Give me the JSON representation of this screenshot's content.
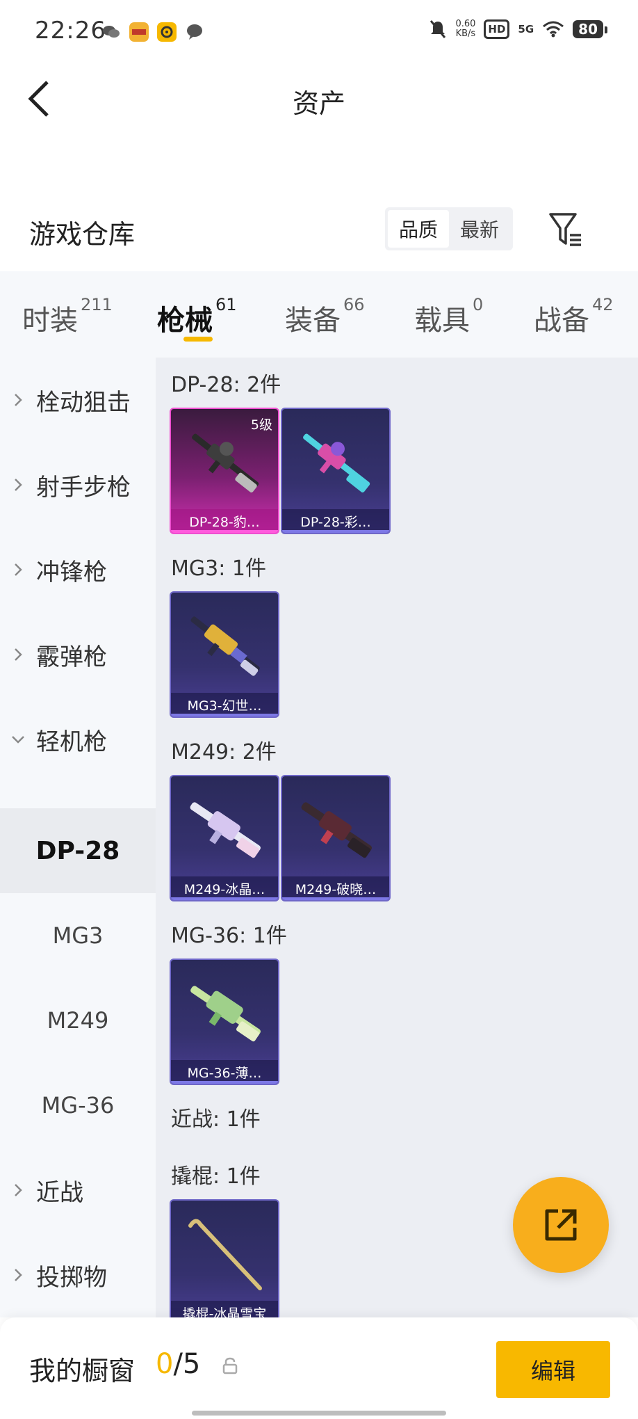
{
  "status_bar": {
    "time": "22:26",
    "net_speed_value": "0.60",
    "net_speed_unit": "KB/s",
    "hd": "HD",
    "network": "5G",
    "battery": "80"
  },
  "header": {
    "title": "资产"
  },
  "warehouse": {
    "title": "游戏仓库",
    "sort_options": [
      "品质",
      "最新"
    ],
    "active_sort": "品质"
  },
  "tabs": [
    {
      "label": "时装",
      "count": "211"
    },
    {
      "label": "枪械",
      "count": "61",
      "active": true
    },
    {
      "label": "装备",
      "count": "66"
    },
    {
      "label": "载具",
      "count": "0"
    },
    {
      "label": "战备",
      "count": "42"
    }
  ],
  "sidebar": [
    {
      "label": "栓动狙击",
      "type": "category"
    },
    {
      "label": "射手步枪",
      "type": "category"
    },
    {
      "label": "冲锋枪",
      "type": "category"
    },
    {
      "label": "霰弹枪",
      "type": "category"
    },
    {
      "label": "轻机枪",
      "type": "category",
      "expanded": true
    },
    {
      "label": "DP-28",
      "type": "sub",
      "selected": true
    },
    {
      "label": "MG3",
      "type": "sub"
    },
    {
      "label": "M249",
      "type": "sub"
    },
    {
      "label": "MG-36",
      "type": "sub"
    },
    {
      "label": "近战",
      "type": "category"
    },
    {
      "label": "投掷物",
      "type": "category"
    }
  ],
  "groups": [
    {
      "label": "DP-28: 2件",
      "items": [
        {
          "name": "DP-28-豹…",
          "level": "5级",
          "rarity": "pink"
        },
        {
          "name": "DP-28-彩…",
          "rarity": "purple"
        }
      ]
    },
    {
      "label": "MG3: 1件",
      "items": [
        {
          "name": "MG3-幻世…",
          "rarity": "purple"
        }
      ]
    },
    {
      "label": "M249: 2件",
      "items": [
        {
          "name": "M249-冰晶…",
          "rarity": "purple"
        },
        {
          "name": "M249-破晓…",
          "rarity": "purple"
        }
      ]
    },
    {
      "label": "MG-36: 1件",
      "items": [
        {
          "name": "MG-36-薄…",
          "rarity": "purple"
        }
      ]
    },
    {
      "label": "近战: 1件",
      "items": []
    },
    {
      "label": "撬棍: 1件",
      "items": [
        {
          "name": "撬棍-冰晶雪宝",
          "rarity": "purple"
        }
      ]
    }
  ],
  "bottom": {
    "showcase_label": "我的橱窗",
    "current": "0",
    "total": "/5",
    "edit_label": "编辑"
  },
  "colors": {
    "accent": "#f8b800",
    "fab": "#f8ae1c",
    "card_purple": "#35316e",
    "card_pink": "#cf2fb0"
  }
}
